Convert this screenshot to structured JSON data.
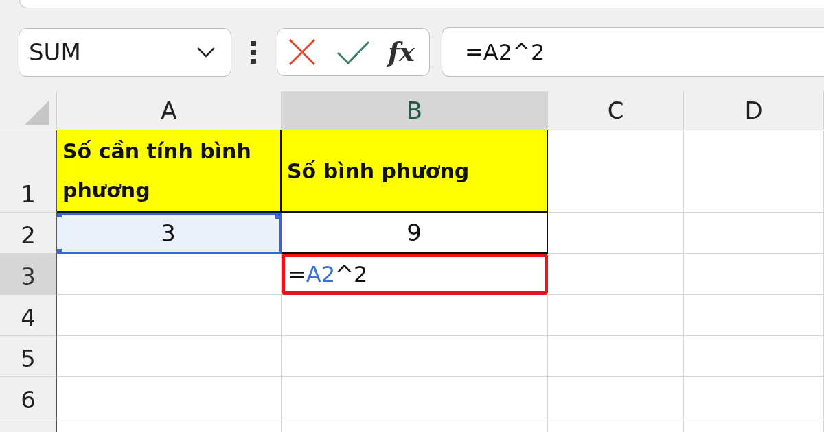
{
  "formula_bar": {
    "name_box": "SUM",
    "insert_function_label": "fx",
    "formula": "=A2^2"
  },
  "sheet": {
    "columns": [
      {
        "label": "A",
        "selected": false
      },
      {
        "label": "B",
        "selected": true
      },
      {
        "label": "C",
        "selected": false
      },
      {
        "label": "D",
        "selected": false
      }
    ],
    "rows": [
      {
        "number": "1",
        "selected": false,
        "cells": [
          {
            "kind": "title",
            "text": "Số cần tính bình phương"
          },
          {
            "kind": "title",
            "text": "Số bình phương"
          }
        ]
      },
      {
        "number": "2",
        "selected": false,
        "cells": [
          {
            "kind": "value",
            "text": "3",
            "referenced": true
          },
          {
            "kind": "value",
            "text": "9",
            "referenced": false
          }
        ]
      },
      {
        "number": "3",
        "selected": true,
        "cells": [
          {
            "kind": "blank"
          },
          {
            "kind": "editing",
            "highlighted": true,
            "parts": [
              {
                "kind": "operator",
                "text": "="
              },
              {
                "kind": "reference",
                "text": "A2"
              },
              {
                "kind": "operator",
                "text": "^2"
              }
            ]
          }
        ]
      },
      {
        "number": "4",
        "selected": false
      },
      {
        "number": "5",
        "selected": false
      },
      {
        "number": "6",
        "selected": false
      },
      {
        "selected": false
      }
    ]
  }
}
